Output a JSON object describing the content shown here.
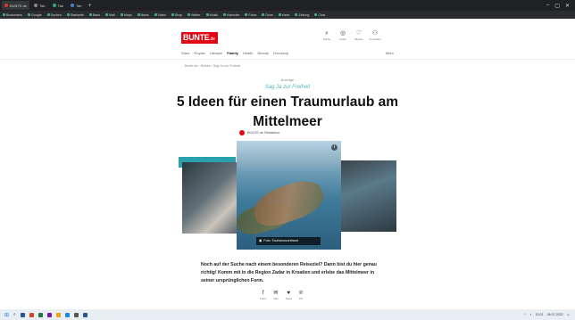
{
  "browser": {
    "tabs": [
      {
        "label": "BUNTE.de",
        "active": true
      },
      {
        "label": "Tab"
      },
      {
        "label": "Tab"
      },
      {
        "label": "Tab"
      }
    ],
    "bookmarks": [
      "Bookmarks",
      "Google",
      "Suchen",
      "Startseite",
      "Bank",
      "Mail",
      "Maps",
      "News",
      "Video",
      "Shop",
      "Wetter",
      "Musik",
      "Kalender",
      "Fotos",
      "Drive",
      "Karte",
      "Zeitung",
      "Chat"
    ]
  },
  "site": {
    "logo_text": "BUNTE",
    "logo_suffix": ".de",
    "header_icons": [
      {
        "icon": "search-icon",
        "glyph": "⌕",
        "label": "Suche"
      },
      {
        "icon": "audio-icon",
        "glyph": "◎",
        "label": "Audio"
      },
      {
        "icon": "heart-icon",
        "glyph": "♡",
        "label": "Merken"
      },
      {
        "icon": "user-icon",
        "glyph": "⚇",
        "label": "Anmelden"
      }
    ],
    "nav": [
      "Stars",
      "Royals",
      "Lifestyle",
      "Family",
      "Health",
      "Beauty",
      "Horoskop"
    ],
    "nav_active_index": 3,
    "nav_right": "Mehr"
  },
  "article": {
    "breadcrumb": "Bunte.de › Reisen › Sag Ja zur Freiheit",
    "ad_tag": "- Anzeige -",
    "kicker": "Sag Ja zur Freiheit",
    "headline_line1": "5 Ideen für einen Traumurlaub am",
    "headline_line2": "Mittelmeer",
    "byline": "BUNTE.de Redaktion",
    "image_caption": "Foto: Tourismusverband",
    "intro": "Noch auf der Suche nach einem besonderen Reiseziel? Dann bist du hier genau richtig! Komm mit in die Region Zadar in Kroatien und erlebe das Mittelmeer in seiner ursprünglichen Form.",
    "share": [
      {
        "icon": "facebook-icon",
        "glyph": "f",
        "label": "Teilen"
      },
      {
        "icon": "mail-icon",
        "glyph": "✉",
        "label": "Mail"
      },
      {
        "icon": "twitter-icon",
        "glyph": "♥",
        "label": "Tweet"
      },
      {
        "icon": "pinterest-icon",
        "glyph": "℗",
        "label": "Pin"
      }
    ]
  },
  "taskbar": {
    "icon_colors": [
      "#2b579a",
      "#d24726",
      "#217346",
      "#7719aa",
      "#e8a317",
      "#1e88e5",
      "#555555",
      "#2b579a"
    ],
    "time": "10:21",
    "date": "26.07.2022"
  }
}
